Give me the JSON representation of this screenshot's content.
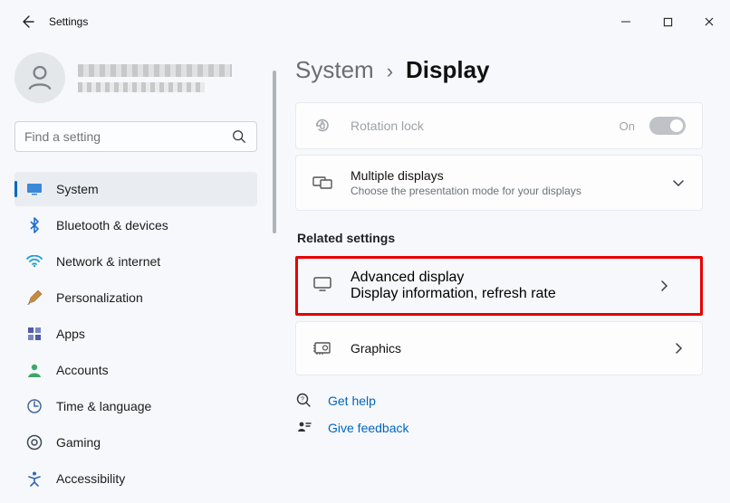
{
  "titlebar": {
    "app_name": "Settings"
  },
  "search": {
    "placeholder": "Find a setting"
  },
  "sidebar": {
    "items": [
      {
        "label": "System"
      },
      {
        "label": "Bluetooth & devices"
      },
      {
        "label": "Network & internet"
      },
      {
        "label": "Personalization"
      },
      {
        "label": "Apps"
      },
      {
        "label": "Accounts"
      },
      {
        "label": "Time & language"
      },
      {
        "label": "Gaming"
      },
      {
        "label": "Accessibility"
      }
    ]
  },
  "breadcrumb": {
    "parent": "System",
    "sep": "›",
    "current": "Display"
  },
  "cards": {
    "rotation": {
      "title": "Rotation lock",
      "state_label": "On"
    },
    "multiple": {
      "title": "Multiple displays",
      "desc": "Choose the presentation mode for your displays"
    },
    "section": "Related settings",
    "advanced": {
      "title": "Advanced display",
      "desc": "Display information, refresh rate"
    },
    "graphics": {
      "title": "Graphics"
    },
    "help": "Get help",
    "feedback": "Give feedback"
  }
}
